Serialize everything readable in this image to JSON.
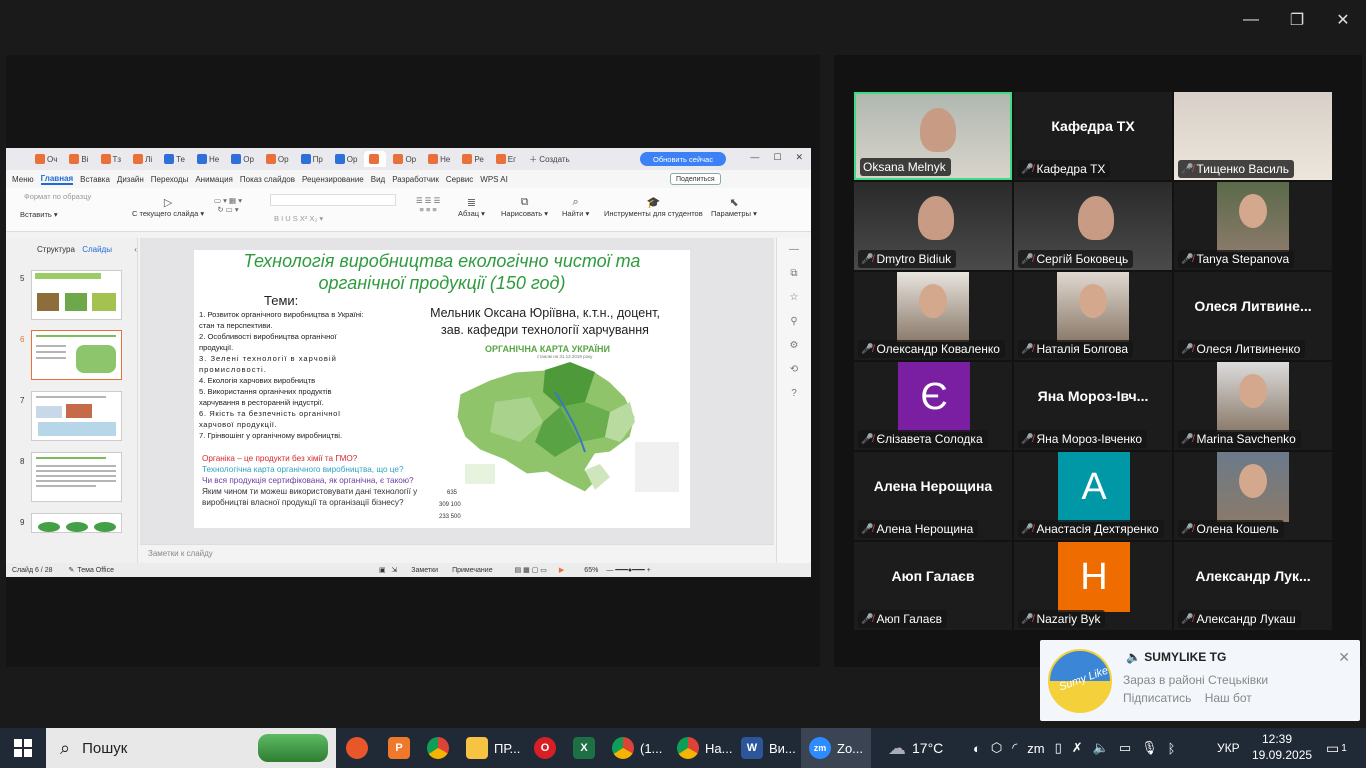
{
  "window_controls": {
    "minimize": "—",
    "restore": "❐",
    "close": "✕"
  },
  "app": {
    "tabs": [
      "Оч",
      "Ві",
      "Тз",
      "Лі",
      "Те",
      "Не",
      "Ор",
      "Ор",
      "Пр",
      "Ор",
      "",
      "Ор",
      "Не",
      "Ре",
      "Ег"
    ],
    "new_tab": "Создать",
    "update_button": "Обновить сейчас",
    "menu": [
      "Меню",
      "Главная",
      "Вставка",
      "Дизайн",
      "Переходы",
      "Анимация",
      "Показ слайдов",
      "Рецензирование",
      "Вид",
      "Разработчик",
      "Сервис",
      "WPS AI"
    ],
    "share_button": "Поделиться",
    "ribbon": {
      "format_painter": "Формат по образцу",
      "paste": "Вставить",
      "from_current": "С текущего слайда",
      "paragraph": "Абзац",
      "draw": "Нарисовать",
      "find": "Найти",
      "tools": "Инструменты для студентов",
      "params": "Параметры"
    },
    "panel": {
      "structure": "Структура",
      "slides": "Слайды"
    },
    "thumb_numbers": [
      "5",
      "6",
      "7",
      "8",
      "9"
    ],
    "notes_placeholder": "Заметки к слайду",
    "status": {
      "slide_of": "Слайд 6 / 28",
      "theme": "Тема Office",
      "notes": "Заметки",
      "comment": "Примечание",
      "zoom": "65%"
    }
  },
  "slide": {
    "title_line1": "Технологія виробництва екологічно чистої та",
    "title_line2": "органічної продукції (150 год)",
    "topics_header": "Теми:",
    "topics": [
      "1. Розвиток органічного виробництва в Україні: стан та перспективи.",
      "2. Особливості виробництва органічної продукції.",
      "3. Зелені технології в харчовій промисловості.",
      "4. Екологія харчових виробництв",
      "5. Використання органічних продуктів харчування в ресторанній індустрії.",
      "6. Якість та безпечність органічної харчової продукції.",
      "7. Грінвошінг у органічному виробництві."
    ],
    "author_line1": "Мельник Оксана Юріївна, к.т.н., доцент,",
    "author_line2": "зав. кафедри технології харчування",
    "map_title": "ОРГАНІЧНА КАРТА УКРАЇНИ",
    "map_subtitle": "станом на 31.12.2019 року",
    "map_numbers": [
      "635",
      "309 100",
      "233 500"
    ],
    "q1": "Органіка – це продукти без хімії та ГМО?",
    "q2": "Технологічна карта органічного виробництва, що це?",
    "q3": "Чи вся продукція сертифікована, як органічна, є такою?",
    "q4": "Яким чином ти можеш використовувати дані технології у виробництві власної продукції та організації бізнесу?"
  },
  "participants": [
    {
      "name": "Oksana Melnyk",
      "type": "video",
      "speaking": true,
      "muted": false
    },
    {
      "name": "Кафедра ТХ",
      "type": "name",
      "muted": true
    },
    {
      "name": "Тищенко Василь",
      "type": "video",
      "muted": true
    },
    {
      "name": "Dmytro Bidiuk",
      "type": "video",
      "muted": true
    },
    {
      "name": "Сергій Боковець",
      "type": "video",
      "muted": true
    },
    {
      "name": "Tanya Stepanova",
      "type": "photo",
      "muted": true
    },
    {
      "name": "Олександр Коваленко",
      "type": "photo",
      "muted": true
    },
    {
      "name": "Наталія Болгова",
      "type": "photo",
      "muted": true
    },
    {
      "name": "Олеся Литвиненко",
      "display": "Олеся  Литвине...",
      "type": "name",
      "muted": true
    },
    {
      "name": "Єлізавета Солодка",
      "letter": "Є",
      "color": "#7b1fa2",
      "type": "letter",
      "muted": true
    },
    {
      "name": "Яна Мороз-Івченко",
      "display": "Яна  Мороз-Івч...",
      "type": "name",
      "muted": true
    },
    {
      "name": "Marina Savchenko",
      "type": "photo",
      "muted": true
    },
    {
      "name": "Алена Нерощина",
      "display": "Алена Нерощина",
      "type": "name",
      "muted": true
    },
    {
      "name": "Анастасія Дехтяренко",
      "letter": "A",
      "color": "#0097a7",
      "type": "letter",
      "muted": true
    },
    {
      "name": "Олена Кошель",
      "type": "photo",
      "muted": true
    },
    {
      "name": "Аюп Галаєв",
      "display": "Аюп Галаєв",
      "type": "name",
      "muted": true
    },
    {
      "name": "Nazariy Byk",
      "letter": "H",
      "color": "#ef6c00",
      "type": "letter",
      "muted": true
    },
    {
      "name": "Александр Лукаш",
      "display": "Александр  Лук...",
      "type": "name",
      "muted": true
    }
  ],
  "notification": {
    "title": "SUMYLIKE TG",
    "message": "Зараз в районі Стецьківки",
    "action1": "Підписатись",
    "action2": "Наш бот",
    "logo_text": "Sumy Like"
  },
  "taskbar": {
    "search": "Пошук",
    "items": [
      {
        "label": "ПР...",
        "icon": "folder-icon"
      },
      {
        "label": "(1...",
        "icon": "chrome-icon"
      },
      {
        "label": "На...",
        "icon": "chrome-icon"
      },
      {
        "label": "Ви...",
        "icon": "word-icon"
      },
      {
        "label": "Zo...",
        "icon": "zoom-icon"
      }
    ],
    "weather": "17°C",
    "language": "УКР",
    "time": "12:39",
    "date": "19.09.2025",
    "notifications_count": "1"
  }
}
